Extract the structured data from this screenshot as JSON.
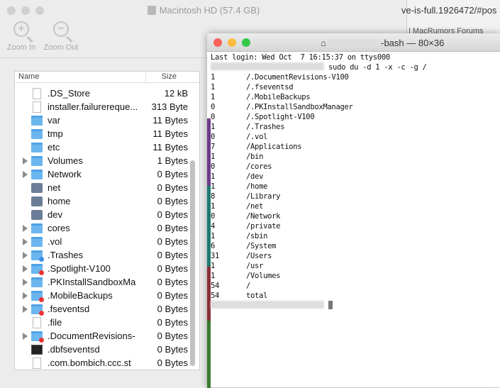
{
  "finder": {
    "title": "Macintosh HD (57.4 GB)",
    "toolbar": {
      "zoom_in": "Zoom In",
      "zoom_out": "Zoom Out"
    },
    "columns": {
      "name": "Name",
      "size": "Size"
    },
    "rows": [
      {
        "name": ".DS_Store",
        "size": "12 kB",
        "icon": "file",
        "expand": false
      },
      {
        "name": "installer.failurereque...",
        "size": "313 Byte",
        "icon": "file",
        "expand": false
      },
      {
        "name": "var",
        "size": "11 Bytes",
        "icon": "folder-alias",
        "expand": false
      },
      {
        "name": "tmp",
        "size": "11 Bytes",
        "icon": "folder-alias",
        "expand": false
      },
      {
        "name": "etc",
        "size": "11 Bytes",
        "icon": "folder-alias",
        "expand": false
      },
      {
        "name": "Volumes",
        "size": "1 Bytes",
        "icon": "folder",
        "expand": true
      },
      {
        "name": "Network",
        "size": "0 Bytes",
        "icon": "folder",
        "expand": true
      },
      {
        "name": "net",
        "size": "0 Bytes",
        "icon": "disk",
        "expand": false
      },
      {
        "name": "home",
        "size": "0 Bytes",
        "icon": "disk",
        "expand": false
      },
      {
        "name": "dev",
        "size": "0 Bytes",
        "icon": "disk",
        "expand": false
      },
      {
        "name": "cores",
        "size": "0 Bytes",
        "icon": "folder",
        "expand": true
      },
      {
        "name": ".vol",
        "size": "0 Bytes",
        "icon": "folder",
        "expand": true
      },
      {
        "name": ".Trashes",
        "size": "0 Bytes",
        "icon": "folder-blue-badge",
        "expand": true
      },
      {
        "name": ".Spotlight-V100",
        "size": "0 Bytes",
        "icon": "folder-locked",
        "expand": true
      },
      {
        "name": ".PKInstallSandboxMa",
        "size": "0 Bytes",
        "icon": "folder",
        "expand": true
      },
      {
        "name": ".MobileBackups",
        "size": "0 Bytes",
        "icon": "folder-locked",
        "expand": true
      },
      {
        "name": ".fseventsd",
        "size": "0 Bytes",
        "icon": "folder-locked",
        "expand": true
      },
      {
        "name": ".file",
        "size": "0 Bytes",
        "icon": "file",
        "expand": false
      },
      {
        "name": ".DocumentRevisions-",
        "size": "0 Bytes",
        "icon": "folder-locked",
        "expand": true
      },
      {
        "name": ".dbfseventsd",
        "size": "0 Bytes",
        "icon": "terminal",
        "expand": false
      },
      {
        "name": ".com.bombich.ccc.st",
        "size": "0 Bytes",
        "icon": "file",
        "expand": false
      }
    ]
  },
  "browser": {
    "url": "ve-is-full.1926472/#pos",
    "tab": "| MacRumors Forums"
  },
  "terminal": {
    "title": "-bash — 80×36",
    "last_login": "Last login: Wed Oct  7 16:15:37 on ttys000",
    "command": "sudo du -d 1 -x -c -g /",
    "output": [
      [
        "1",
        "/.DocumentRevisions-V100"
      ],
      [
        "1",
        "/.fseventsd"
      ],
      [
        "1",
        "/.MobileBackups"
      ],
      [
        "0",
        "/.PKInstallSandboxManager"
      ],
      [
        "0",
        "/.Spotlight-V100"
      ],
      [
        "1",
        "/.Trashes"
      ],
      [
        "0",
        "/.vol"
      ],
      [
        "7",
        "/Applications"
      ],
      [
        "1",
        "/bin"
      ],
      [
        "0",
        "/cores"
      ],
      [
        "1",
        "/dev"
      ],
      [
        "1",
        "/home"
      ],
      [
        "8",
        "/Library"
      ],
      [
        "1",
        "/net"
      ],
      [
        "0",
        "/Network"
      ],
      [
        "4",
        "/private"
      ],
      [
        "1",
        "/sbin"
      ],
      [
        "6",
        "/System"
      ],
      [
        "31",
        "/Users"
      ],
      [
        "1",
        "/usr"
      ],
      [
        "1",
        "/Volumes"
      ],
      [
        "54",
        "/"
      ],
      [
        "54",
        "total"
      ]
    ]
  }
}
